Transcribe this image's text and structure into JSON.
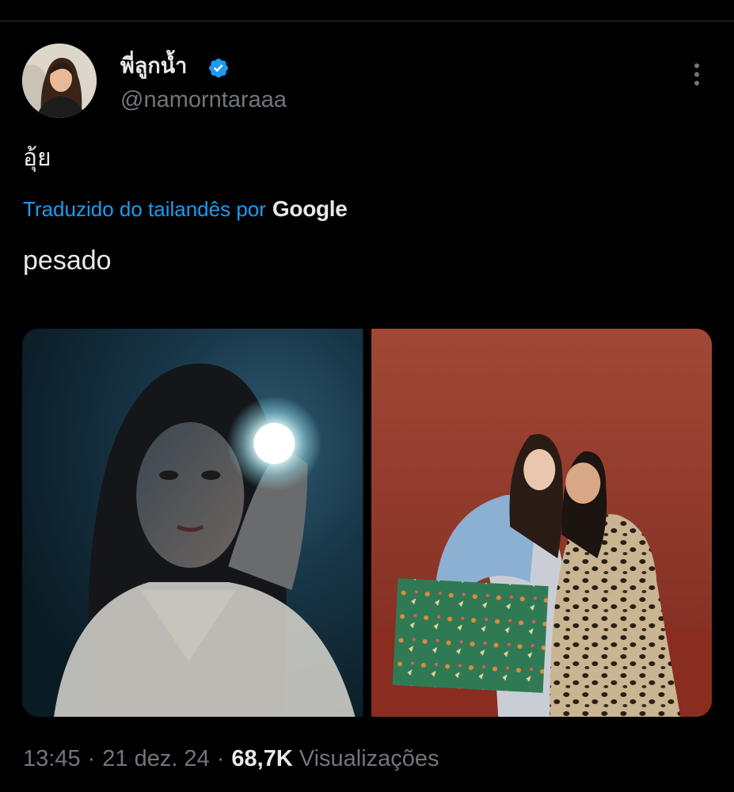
{
  "tweet": {
    "author": {
      "display_name": "พี่ลูกน้ำ",
      "handle": "@namorntaraaa",
      "verified": true,
      "avatar_icon": "profile-photo"
    },
    "more_icon": "more-dots-vertical-icon",
    "text": "อุ้ย",
    "translation": {
      "link_text": "Traduzido do tailandês por",
      "provider": "Google",
      "translated_text": "pesado"
    },
    "media": [
      {
        "description_icon": "photo-flashlight-portrait"
      },
      {
        "description_icon": "photo-two-friends-red-wall"
      }
    ],
    "meta": {
      "time": "13:45",
      "separator": "·",
      "date": "21 dez. 24",
      "views_count": "68,7K",
      "views_label": "Visualizações"
    }
  },
  "colors": {
    "background": "#000000",
    "text_primary": "#e7e9ea",
    "text_secondary": "#71767b",
    "link": "#1d9bf0",
    "verified_badge": "#1d9bf0",
    "divider": "#2f3336"
  }
}
